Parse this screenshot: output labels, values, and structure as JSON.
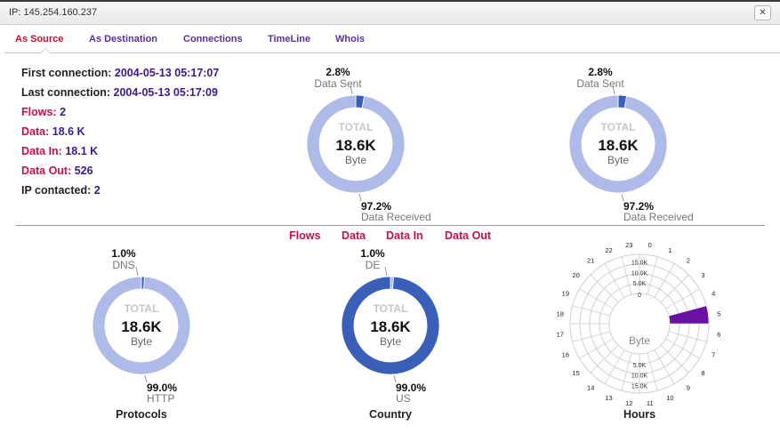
{
  "window": {
    "title": "IP: 145.254.160.237",
    "close_icon": "close-icon"
  },
  "tabs": [
    {
      "label": "As Source",
      "active": true
    },
    {
      "label": "As Destination",
      "active": false
    },
    {
      "label": "Connections",
      "active": false
    },
    {
      "label": "TimeLine",
      "active": false
    },
    {
      "label": "Whois",
      "active": false
    }
  ],
  "stats": {
    "first_connection": {
      "label": "First connection:",
      "value": "2004-05-13 05:17:07"
    },
    "last_connection": {
      "label": "Last connection:",
      "value": "2004-05-13 05:17:09"
    },
    "flows": {
      "label": "Flows:",
      "value": "2"
    },
    "data": {
      "label": "Data:",
      "value": "18.6 K"
    },
    "data_in": {
      "label": "Data In:",
      "value": "18.1 K"
    },
    "data_out": {
      "label": "Data Out:",
      "value": "526"
    },
    "ip_contacted": {
      "label": "IP contacted:",
      "value": "2"
    }
  },
  "metric_selector": [
    "Flows",
    "Data",
    "Data In",
    "Data Out"
  ],
  "colors": {
    "accent_red": "#c8104a",
    "value_purple": "#3d1a8c",
    "tab_purple": "#5b2fa0",
    "donut_light": "#aebbe8",
    "donut_dark": "#3a5fb8",
    "polar_fill": "#6a12a6"
  },
  "chart_data": [
    {
      "type": "pie",
      "center_label": "TOTAL",
      "center_value": "18.6K",
      "center_unit": "Byte",
      "slices": [
        {
          "label": "Data Sent",
          "percent_label": "2.8%",
          "value": 2.8,
          "color": "#3a5fb8"
        },
        {
          "label": "Data Received",
          "percent_label": "97.2%",
          "value": 97.2,
          "color": "#aebbe8"
        }
      ]
    },
    {
      "type": "pie",
      "center_label": "TOTAL",
      "center_value": "18.6K",
      "center_unit": "Byte",
      "slices": [
        {
          "label": "Data Sent",
          "percent_label": "2.8%",
          "value": 2.8,
          "color": "#3a5fb8"
        },
        {
          "label": "Data Received",
          "percent_label": "97.2%",
          "value": 97.2,
          "color": "#aebbe8"
        }
      ]
    },
    {
      "type": "pie",
      "caption": "Protocols",
      "center_label": "TOTAL",
      "center_value": "18.6K",
      "center_unit": "Byte",
      "slices": [
        {
          "label": "DNS",
          "percent_label": "1.0%",
          "value": 1.0,
          "color": "#3a5fb8"
        },
        {
          "label": "HTTP",
          "percent_label": "99.0%",
          "value": 99.0,
          "color": "#aebbe8"
        }
      ]
    },
    {
      "type": "pie",
      "caption": "Country",
      "center_label": "TOTAL",
      "center_value": "18.6K",
      "center_unit": "Byte",
      "slices": [
        {
          "label": "DE",
          "percent_label": "1.0%",
          "value": 1.0,
          "color": "#aebbe8"
        },
        {
          "label": "US",
          "percent_label": "99.0%",
          "value": 99.0,
          "color": "#3a5fb8"
        }
      ]
    },
    {
      "type": "polar_bar",
      "caption": "Hours",
      "center_unit": "Byte",
      "categories": [
        "0",
        "1",
        "2",
        "3",
        "4",
        "5",
        "6",
        "7",
        "8",
        "9",
        "10",
        "11",
        "12",
        "13",
        "14",
        "15",
        "16",
        "17",
        "18",
        "19",
        "20",
        "21",
        "22",
        "23"
      ],
      "values": [
        0,
        0,
        0,
        0,
        0,
        18600,
        0,
        0,
        0,
        0,
        0,
        0,
        0,
        0,
        0,
        0,
        0,
        0,
        0,
        0,
        0,
        0,
        0,
        0
      ],
      "radial_ticks": [
        "0",
        "5.0K",
        "10.0K",
        "15.0K"
      ],
      "radial_max": 18600
    }
  ]
}
